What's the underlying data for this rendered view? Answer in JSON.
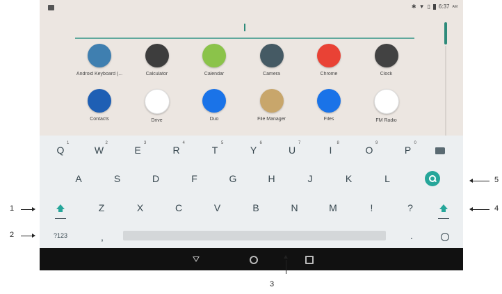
{
  "status_bar": {
    "time": "6:37",
    "ampm": "AM",
    "icons": [
      "bluetooth-icon",
      "wifi-icon",
      "no-sim-icon",
      "battery-icon"
    ]
  },
  "apps_row1": [
    {
      "label": "Android Keyboard (...",
      "icon": "keyboard-app-icon",
      "color": "#3f7fb0"
    },
    {
      "label": "Calculator",
      "icon": "calculator-app-icon",
      "color": "#3d3d3d"
    },
    {
      "label": "Calendar",
      "icon": "calendar-app-icon",
      "color": "#8bc34a"
    },
    {
      "label": "Camera",
      "icon": "camera-app-icon",
      "color": "#455a64"
    },
    {
      "label": "Chrome",
      "icon": "chrome-app-icon",
      "color": "#e94235"
    },
    {
      "label": "Clock",
      "icon": "clock-app-icon",
      "color": "#424242"
    }
  ],
  "apps_row2": [
    {
      "label": "Contacts",
      "icon": "contacts-app-icon",
      "color": "#1e5fb4"
    },
    {
      "label": "Drive",
      "icon": "drive-app-icon",
      "color": "#ffffff"
    },
    {
      "label": "Duo",
      "icon": "duo-app-icon",
      "color": "#1a73e8"
    },
    {
      "label": "File Manager",
      "icon": "file-manager-app-icon",
      "color": "#c8a66b"
    },
    {
      "label": "Files",
      "icon": "files-app-icon",
      "color": "#1a73e8"
    },
    {
      "label": "FM Radio",
      "icon": "fm-radio-app-icon",
      "color": "#ffffff"
    }
  ],
  "keyboard": {
    "row1": [
      {
        "key": "Q",
        "hint": "1"
      },
      {
        "key": "W",
        "hint": "2"
      },
      {
        "key": "E",
        "hint": "3"
      },
      {
        "key": "R",
        "hint": "4"
      },
      {
        "key": "T",
        "hint": "5"
      },
      {
        "key": "Y",
        "hint": "6"
      },
      {
        "key": "U",
        "hint": "7"
      },
      {
        "key": "I",
        "hint": "8"
      },
      {
        "key": "O",
        "hint": "9"
      },
      {
        "key": "P",
        "hint": "0"
      }
    ],
    "row2": [
      "A",
      "S",
      "D",
      "F",
      "G",
      "H",
      "J",
      "K",
      "L"
    ],
    "row3": [
      "Z",
      "X",
      "C",
      "V",
      "B",
      "N",
      "M",
      "!",
      "?"
    ],
    "symbols_key": "?123",
    "comma_key": ",",
    "period_key": ".",
    "accent_color": "#26a69a"
  },
  "callouts": {
    "c1": "1",
    "c2": "2",
    "c3": "3",
    "c4": "4",
    "c5": "5"
  }
}
